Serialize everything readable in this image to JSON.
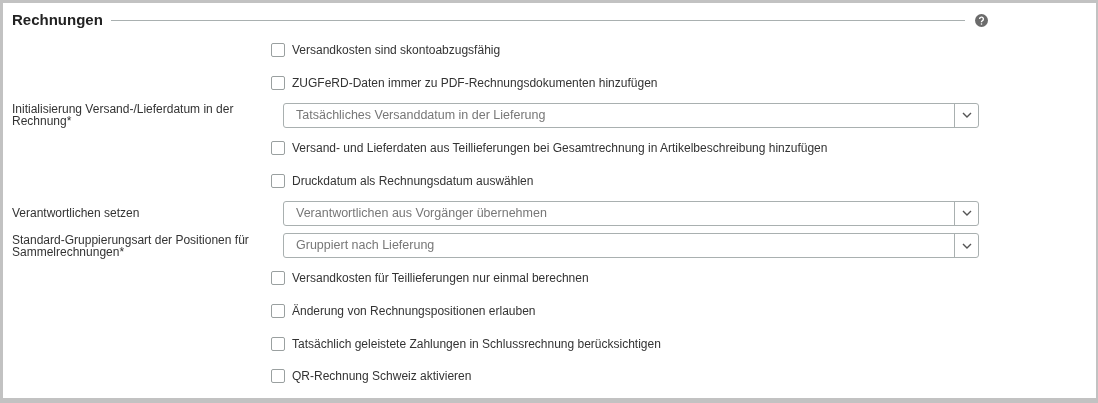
{
  "section": {
    "title": "Rechnungen"
  },
  "rows": [
    {
      "kind": "checkbox",
      "text": "Versandkosten sind skontoabzugsfähig",
      "checked": false
    },
    {
      "kind": "checkbox",
      "text": "ZUGFeRD-Daten immer zu PDF-Rechnungsdokumenten hinzufügen",
      "checked": false
    },
    {
      "kind": "select",
      "label": "Initialisierung Versand-/Lieferdatum in der Rechnung*",
      "value": "Tatsächliches Versanddatum in der Lieferung"
    },
    {
      "kind": "checkbox",
      "text": "Versand- und Lieferdaten aus Teillieferungen bei Gesamtrechnung in Artikelbeschreibung hinzufügen",
      "checked": false
    },
    {
      "kind": "checkbox",
      "text": "Druckdatum als Rechnungsdatum auswählen",
      "checked": false
    },
    {
      "kind": "select",
      "label": "Verantwortlichen setzen",
      "value": "Verantwortlichen aus Vorgänger übernehmen"
    },
    {
      "kind": "select",
      "label": "Standard-Gruppierungsart der Positionen für Sammelrechnungen*",
      "value": "Gruppiert nach Lieferung"
    },
    {
      "kind": "checkbox",
      "text": "Versandkosten für Teillieferungen nur einmal berechnen",
      "checked": false
    },
    {
      "kind": "checkbox",
      "text": "Änderung von Rechnungspositionen erlauben",
      "checked": false
    },
    {
      "kind": "checkbox",
      "text": "Tatsächlich geleistete Zahlungen in Schlussrechnung berücksichtigen",
      "checked": false
    },
    {
      "kind": "checkbox",
      "text": "QR-Rechnung Schweiz aktivieren",
      "checked": false
    }
  ]
}
